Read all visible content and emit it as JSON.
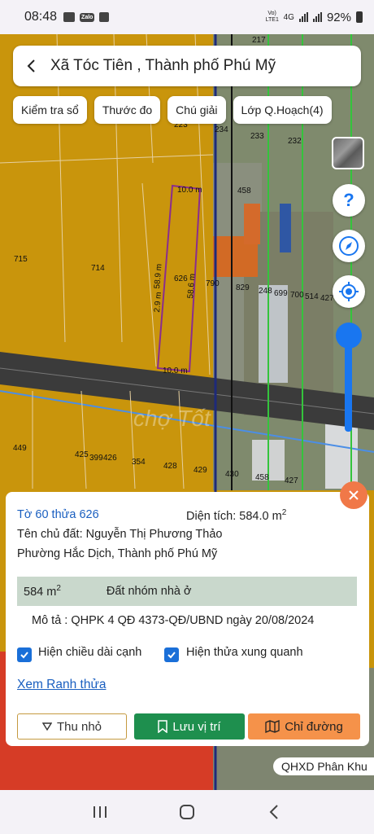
{
  "status": {
    "time": "08:48",
    "network": "4G",
    "volte": "Vo) LTE1",
    "battery": "92%"
  },
  "header": {
    "title": "Xã Tóc Tiên , Thành phố Phú Mỹ"
  },
  "chips": [
    "Kiểm tra sổ",
    "Thước đo",
    "Chú giải",
    "Lớp Q.Hoạch(4)"
  ],
  "map": {
    "parcel_labels": [
      "217",
      "223",
      "234",
      "233",
      "232",
      "458",
      "715",
      "714",
      "626",
      "790",
      "829",
      "248",
      "699",
      "700",
      "514",
      "427",
      "449",
      "425",
      "399",
      "426",
      "354",
      "428",
      "429",
      "430",
      "458",
      "427"
    ],
    "dimension_labels": [
      "10.0 m",
      "58.9 m",
      "58.6 m",
      "10.0 m",
      "2.9 m"
    ],
    "watermark": "chợ Tốt"
  },
  "panel": {
    "parcel_ref": "Tờ 60 thửa 626",
    "area_label": "Diện tích: ",
    "area_value": "584.0 m",
    "area_sup": "2",
    "owner_label": "Tên chủ đất: ",
    "owner_name": "Nguyễn Thị Phương Thảo",
    "address": "Phường Hắc Dịch, Thành phố Phú Mỹ",
    "zone_area": "584 m",
    "zone_sup": "2",
    "zone_type": "Đất nhóm nhà ở",
    "description": "Mô tả : QHPK 4 QĐ 4373-QĐ/UBND ngày 20/08/2024",
    "check_edge_length": "Hiện chiều dài cạnh",
    "check_neighbors": "Hiện thửa xung quanh",
    "link_boundary": "Xem Ranh thửa",
    "btn_collapse": "Thu nhỏ",
    "btn_save": "Lưu vị trí",
    "btn_directions": "Chỉ đường"
  },
  "badge": "QHXD Phân Khu",
  "colors": {
    "accent_blue": "#1976f0",
    "save_green": "#1e8f4e",
    "directions_orange": "#f5924a",
    "zone_band": "#c9d8cc"
  }
}
